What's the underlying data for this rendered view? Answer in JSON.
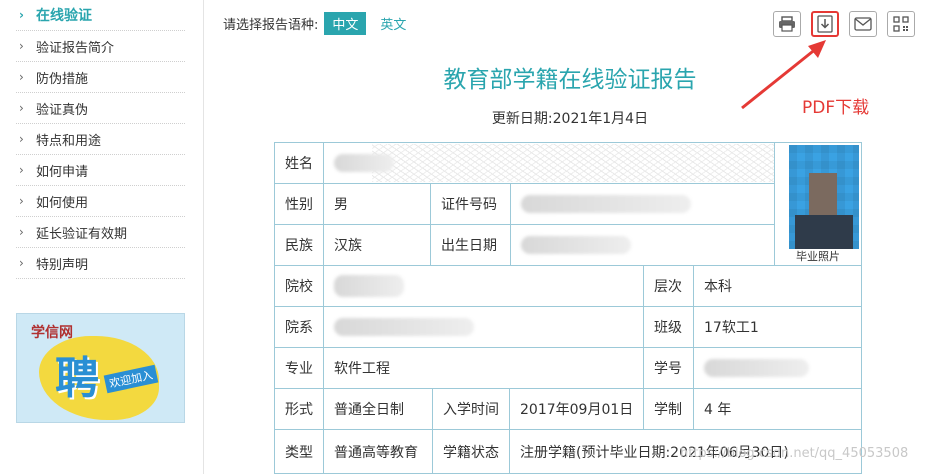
{
  "sidebar": {
    "items": [
      {
        "label": "在线验证",
        "active": true
      },
      {
        "label": "验证报告简介",
        "active": false
      },
      {
        "label": "防伪措施",
        "active": false
      },
      {
        "label": "验证真伪",
        "active": false
      },
      {
        "label": "特点和用途",
        "active": false
      },
      {
        "label": "如何申请",
        "active": false
      },
      {
        "label": "如何使用",
        "active": false
      },
      {
        "label": "延长验证有效期",
        "active": false
      },
      {
        "label": "特别声明",
        "active": false
      }
    ],
    "banner": {
      "brand": "学信网",
      "headline": "聘",
      "tagline": "欢迎加入"
    }
  },
  "header": {
    "lang_prompt": "请选择报告语种:",
    "lang_options": [
      "中文",
      "英文"
    ],
    "lang_selected": "中文",
    "tools": [
      "printer-icon",
      "pdf-download-icon",
      "mail-icon",
      "qr-code-icon"
    ],
    "annotation": "PDF下载",
    "accent_color": "#2aa5ae",
    "annotation_color": "#e53935"
  },
  "report": {
    "title": "教育部学籍在线验证报告",
    "update_label": "更新日期:",
    "update_date": "2021年1月4日"
  },
  "fields": {
    "name_label": "姓名",
    "gender_label": "性别",
    "gender": "男",
    "id_label": "证件号码",
    "ethnicity_label": "民族",
    "ethnicity": "汉族",
    "birth_label": "出生日期",
    "photo_caption": "毕业照片",
    "school_label": "院校",
    "level_label": "层次",
    "level": "本科",
    "dept_label": "院系",
    "class_label": "班级",
    "class": "17软工1",
    "major_label": "专业",
    "major": "软件工程",
    "student_no_label": "学号",
    "form_label": "形式",
    "form": "普通全日制",
    "enroll_label": "入学时间",
    "enroll": "2017年09月01日",
    "duration_label": "学制",
    "duration": "4 年",
    "type_label": "类型",
    "type": "普通高等教育",
    "status_label": "学籍状态",
    "status": "注册学籍(预计毕业日期:2021年06月30日)"
  },
  "watermark": "https://blog.csdn.net/qq_45053508"
}
